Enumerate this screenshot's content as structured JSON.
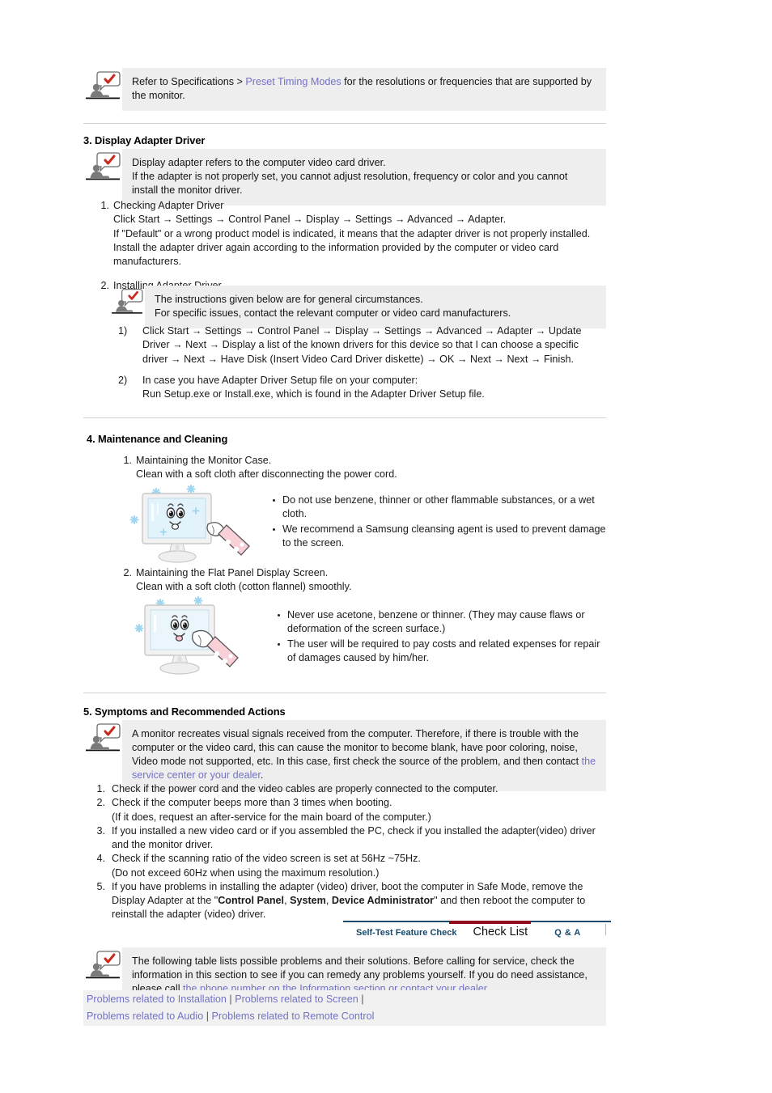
{
  "notes": {
    "preset_timing": {
      "text_before": "Refer to Specifications > ",
      "link": "Preset Timing Modes",
      "text_after": " for the resolutions or frequencies that are supported by the monitor."
    },
    "display_adapter": {
      "line1": "Display adapter refers to the computer video card driver.",
      "line2": "If the adapter is not properly set, you cannot adjust resolution, frequency or color and you cannot install the monitor driver."
    },
    "general_circumstances": {
      "line1": "The instructions given below are for general circumstances.",
      "line2": "For specific issues, contact the relevant computer or video card manufacturers."
    },
    "symptoms": {
      "text_before": "A monitor recreates visual signals received from the computer. Therefore, if there is trouble with the computer or the video card, this can cause the monitor to become blank, have poor coloring, noise, Video mode not supported, etc. In this case, first check the source of the problem, and then contact ",
      "link": "the service center or your dealer",
      "text_after": "."
    },
    "checklist": {
      "text_before": "The following table lists possible problems and their solutions. Before calling for service, check the information in this section to see if you can remedy any problems yourself. If you do need assistance, please call ",
      "link": "the phone number on the Information section or contact your dealer",
      "text_after": "."
    }
  },
  "sections": {
    "display_adapter_driver": {
      "heading": "3. Display Adapter Driver",
      "items": [
        {
          "marker": "1.",
          "line1": "Checking Adapter Driver",
          "line2": "Click Start → Settings → Control Panel → Display → Settings → Advanced → Adapter.",
          "line3": "If \"Default\" or a wrong product model is indicated, it means that the adapter driver is not properly installed. Install the adapter driver again according to the information provided by the computer or video card manufacturers."
        },
        {
          "marker": "2.",
          "line1": "Installing Adapter Driver"
        }
      ],
      "sub_items": [
        {
          "marker": "1)",
          "text": "Click Start → Settings → Control Panel → Display → Settings → Advanced → Adapter → Update Driver → Next → Display a list of the known drivers for this device so that I can choose a specific driver → Next → Have Disk (Insert Video Card Driver diskette) → OK → Next → Next → Finish."
        },
        {
          "marker": "2)",
          "line1": "In case you have Adapter Driver Setup file on your computer:",
          "line2": "Run Setup.exe or Install.exe, which is found in the Adapter Driver Setup file."
        }
      ]
    },
    "maintenance": {
      "heading": "4. Maintenance and Cleaning",
      "item1": {
        "marker": "1.",
        "line1": "Maintaining the Monitor Case.",
        "line2": "Clean with a soft cloth after disconnecting the power cord.",
        "bullets": [
          "Do not use benzene, thinner or other flammable substances, or a wet cloth.",
          "We recommend a Samsung cleansing agent is used to prevent damage to the screen."
        ]
      },
      "item2": {
        "marker": "2.",
        "line1": "Maintaining the Flat Panel Display Screen.",
        "line2": "Clean with a soft cloth (cotton flannel) smoothly.",
        "bullets": [
          "Never use acetone, benzene or thinner. (They may cause flaws or deformation of the screen surface.)",
          "The user will be required to pay costs and related expenses for repair of damages caused by him/her."
        ]
      }
    },
    "symptoms": {
      "heading": "5. Symptoms and Recommended Actions",
      "items": [
        {
          "marker": "1.",
          "line1": "Check if the power cord and the video cables are properly connected to the computer."
        },
        {
          "marker": "2.",
          "line1": "Check if the computer beeps more than 3 times when booting.",
          "line2": "(If it does, request an after-service for the main board of the computer.)"
        },
        {
          "marker": "3.",
          "line1": "If you installed a new video card or if you assembled the PC, check if you installed the adapter(video) driver and the monitor driver."
        },
        {
          "marker": "4.",
          "line1": "Check if the scanning ratio of the video screen is set at 56Hz ~75Hz.",
          "line2": "(Do not exceed 60Hz when using the maximum resolution.)"
        },
        {
          "marker": "5.",
          "part1": "If you have problems in installing the adapter (video) driver, boot the computer in Safe Mode, remove the Display Adapter at the \"",
          "bold1": "Control Panel",
          "mid1": ", ",
          "bold2": "System",
          "mid2": ", ",
          "bold3": "Device Administrator",
          "part2": "\" and then reboot the computer to reinstall the adapter (video) driver."
        }
      ]
    }
  },
  "tabs": {
    "self_test": "Self-Test Feature Check",
    "check_list": "Check List",
    "qa": "Q & A",
    "active_color": "#8f0b1c",
    "text_color": "#19496b"
  },
  "bottom_links": {
    "row1": {
      "link1": "Problems related to Installation",
      "sep1": " | ",
      "link2": "Problems related to Screen",
      "sep2": " |"
    },
    "row2": {
      "link1": "Problems related to Audio",
      "sep1": " | ",
      "link2": "Problems related to Remote Control"
    }
  },
  "colors": {
    "link": "#7272c4",
    "note_bg": "#eeeeee",
    "linkrow_bg": "#f1f1f1",
    "divider": "#cfcfcf"
  }
}
